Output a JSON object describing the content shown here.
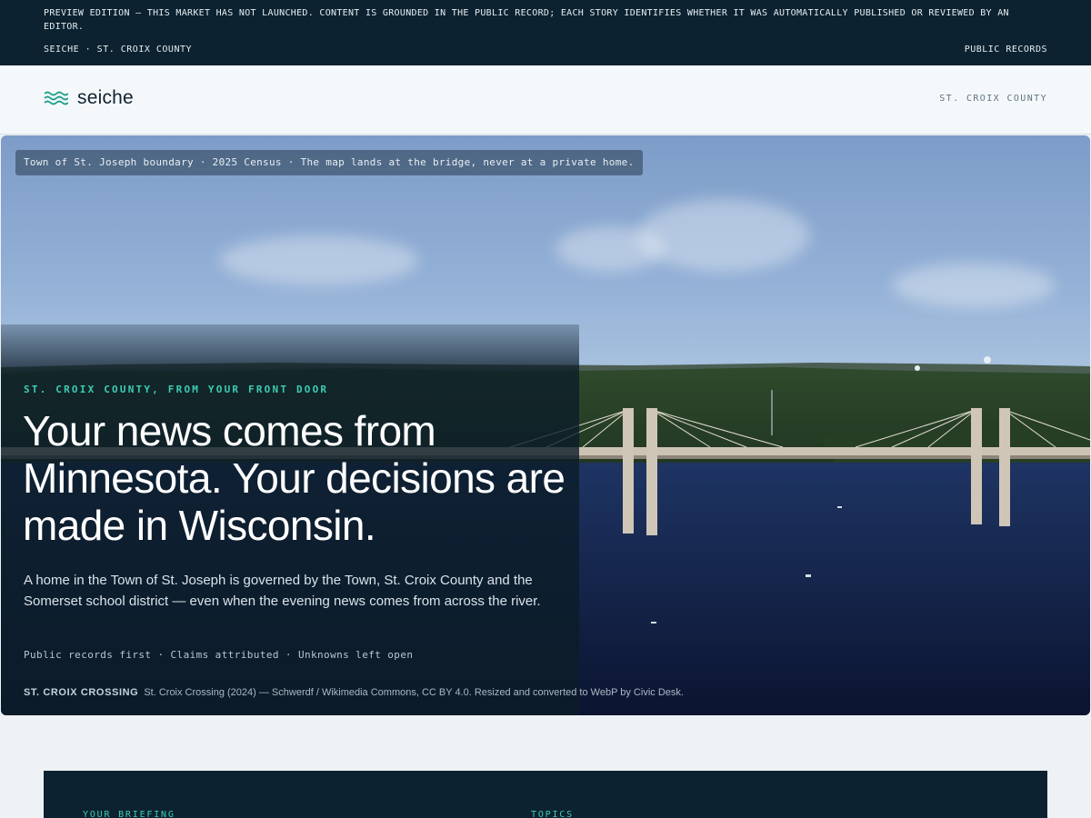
{
  "notice": {
    "text": "PREVIEW EDITION — THIS MARKET HAS NOT LAUNCHED. CONTENT IS GROUNDED IN THE PUBLIC RECORD; EACH STORY IDENTIFIES WHETHER IT WAS AUTOMATICALLY PUBLISHED OR REVIEWED BY AN EDITOR.",
    "left": "SEICHE · ST. CROIX COUNTY",
    "right": "PUBLIC RECORDS"
  },
  "header": {
    "brand": "seiche",
    "region": "ST. CROIX COUNTY",
    "logo_icon": "waves-icon"
  },
  "hero": {
    "map_tag": "Town of St. Joseph boundary · 2025 Census · The map lands at the bridge, never at a private home.",
    "eyebrow": "ST. CROIX COUNTY, FROM YOUR FRONT DOOR",
    "headline": "Your news comes from Minnesota. Your decisions are made in Wisconsin.",
    "dek": "A home in the Town of St. Joseph is governed by the Town, St. Croix County and the Somerset school district — even when the evening news comes from across the river.",
    "values": "Public records first · Claims attributed · Unknowns left open",
    "credit_label": "ST. CROIX CROSSING",
    "credit_text": "St. Croix Crossing (2024) — Schwerdf / Wikimedia Commons, CC BY 4.0. Resized and converted to WebP by Civic Desk."
  },
  "briefing": {
    "left_label": "YOUR BRIEFING",
    "right_label": "TOPICS"
  },
  "colors": {
    "accent": "#3ccdb3",
    "navy": "#0c2230",
    "header_bg": "#f5f8fa"
  }
}
